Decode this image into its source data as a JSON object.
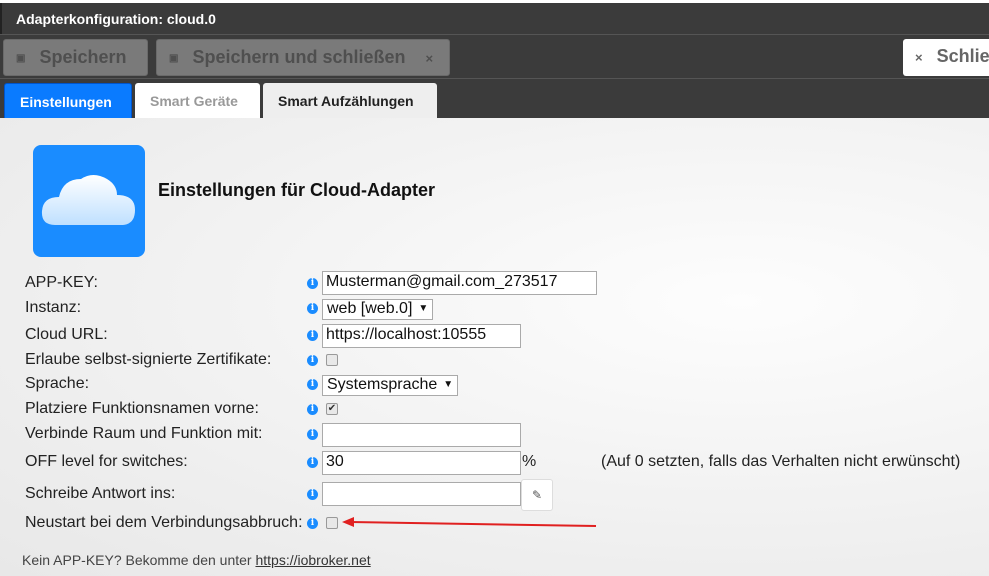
{
  "window": {
    "title": "Adapterkonfiguration: cloud.0"
  },
  "toolbar": {
    "save": "Speichern",
    "save_close": "Speichern und schließen",
    "close": "Schließen",
    "close_x": "×"
  },
  "tabs": [
    {
      "label": "Einstellungen",
      "active": true
    },
    {
      "label": "Smart Geräte"
    },
    {
      "label": "Smart Aufzählungen"
    }
  ],
  "heading": "Einstellungen für Cloud-Adapter",
  "form": {
    "app_key": {
      "label": "APP-KEY:",
      "value": "Musterman@gmail.com_273517"
    },
    "instance": {
      "label": "Instanz:",
      "value": "web [web.0]"
    },
    "cloud_url": {
      "label": "Cloud URL:",
      "value": "https://localhost:10555"
    },
    "self_signed": {
      "label": "Erlaube selbst-signierte Zertifikate:",
      "checked": false
    },
    "language": {
      "label": "Sprache:",
      "value": "Systemsprache"
    },
    "func_first": {
      "label": "Platziere Funktionsnamen vorne:",
      "checked": true
    },
    "concat": {
      "label": "Verbinde Raum und Funktion mit:",
      "value": ""
    },
    "off_level": {
      "label": "OFF level for switches:",
      "value": "30",
      "unit": "%",
      "hint": "(Auf 0 setzten, falls das Verhalten nicht erwünscht)"
    },
    "response": {
      "label": "Schreibe Antwort ins:",
      "value": ""
    },
    "restart": {
      "label": "Neustart bei dem Verbindungsabbruch:",
      "checked": false
    }
  },
  "footer": {
    "text": "Kein APP-KEY? Bekomme den unter ",
    "link": "https://iobroker.net"
  },
  "colors": {
    "accent": "#1a8cff",
    "dark": "#3b3b3b",
    "arrow": "#e02020"
  }
}
